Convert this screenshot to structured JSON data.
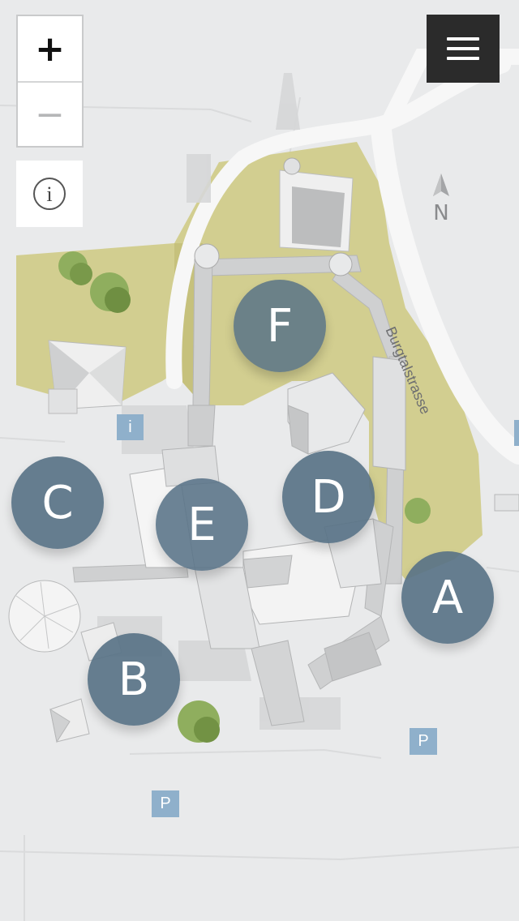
{
  "controls": {
    "zoom_in": "+",
    "zoom_out": "−",
    "info": "i",
    "menu_icon": "hamburger-menu-icon"
  },
  "markers": [
    {
      "id": "A",
      "label": "A"
    },
    {
      "id": "B",
      "label": "B"
    },
    {
      "id": "C",
      "label": "C"
    },
    {
      "id": "D",
      "label": "D"
    },
    {
      "id": "E",
      "label": "E"
    },
    {
      "id": "F",
      "label": "F"
    }
  ],
  "poi": {
    "info_point": "i",
    "parking_1": "P",
    "parking_2": "P"
  },
  "map": {
    "street": "Burgtalstrasse",
    "compass": "N",
    "colors": {
      "background": "#e9eaeb",
      "road": "#f6f6f6",
      "meadow": "#cfcb86",
      "marker": "#597387",
      "poi": "#8fb0cb",
      "buildings": "#d9dadb"
    }
  }
}
